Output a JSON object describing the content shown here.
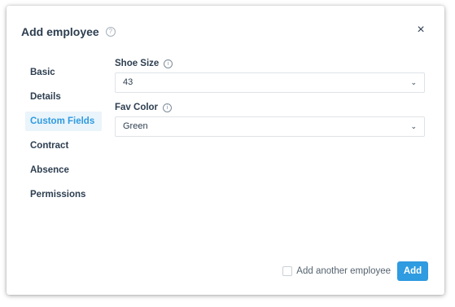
{
  "dialog": {
    "title": "Add employee",
    "help_icon": "help-circle-icon",
    "close_icon": "close-icon",
    "close_glyph": "×"
  },
  "nav": {
    "items": [
      {
        "label": "Basic",
        "active": false
      },
      {
        "label": "Details",
        "active": false
      },
      {
        "label": "Custom Fields",
        "active": true
      },
      {
        "label": "Contract",
        "active": false
      },
      {
        "label": "Absence",
        "active": false
      },
      {
        "label": "Permissions",
        "active": false
      }
    ]
  },
  "fields": [
    {
      "label": "Shoe Size",
      "value": "43",
      "info_icon": "info-icon"
    },
    {
      "label": "Fav Color",
      "value": "Green",
      "info_icon": "info-icon"
    }
  ],
  "footer": {
    "checkbox_label": "Add another employee",
    "checkbox_checked": false,
    "add_label": "Add"
  },
  "colors": {
    "accent": "#2f9be0",
    "active_nav_bg": "#eaf4fb",
    "text": "#2d3e50"
  }
}
